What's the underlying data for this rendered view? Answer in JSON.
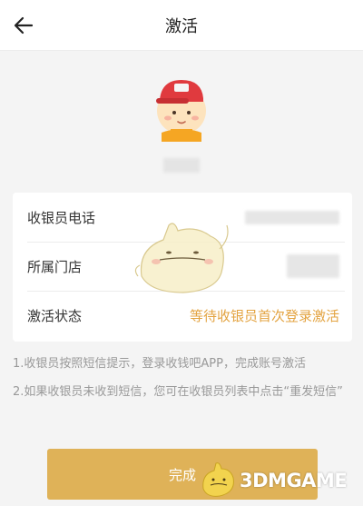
{
  "header": {
    "title": "激活",
    "back_icon": "arrow-left-icon"
  },
  "profile": {
    "avatar_icon": "cashier-avatar-icon"
  },
  "info": {
    "rows": [
      {
        "label": "收银员电话",
        "value": ""
      },
      {
        "label": "所属门店",
        "value": ""
      },
      {
        "label": "激活状态",
        "value": "等待收银员首次登录激活"
      }
    ]
  },
  "notes": [
    "1.收银员按照短信提示，登录收钱吧APP，完成账号激活",
    "2.如果收银员未收到短信，您可在收银员列表中点击“重发短信”"
  ],
  "footer": {
    "done_label": "完成"
  },
  "watermark": {
    "text": "3DMGAME"
  },
  "colors": {
    "accent": "#dfb258",
    "status": "#e3a340",
    "background": "#f4f4f4"
  }
}
